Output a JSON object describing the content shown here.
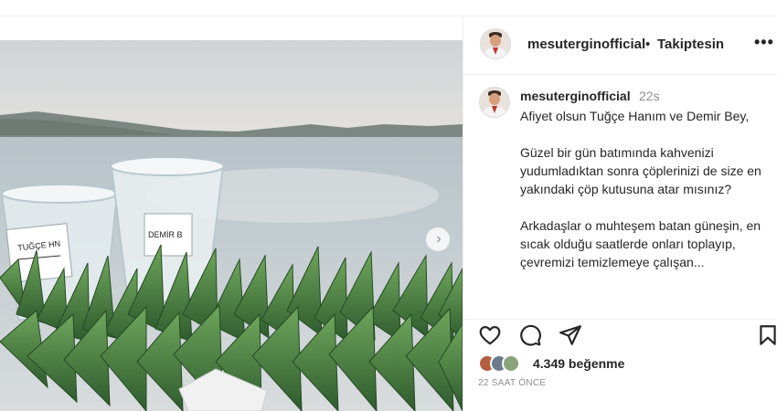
{
  "post": {
    "username": "mesuterginofficial",
    "separator": "•",
    "follow_status": "Takiptesin",
    "more_label": "•••",
    "next_label": "›",
    "cup_left_label": "TUĞÇE HN",
    "cup_right_label": "DEMİR B",
    "comment": {
      "username": "mesuterginofficial",
      "time": "22s",
      "lines": [
        "Afiyet olsun Tuğçe Hanım ve Demir Bey,",
        "Güzel bir gün batımında kahvenizi yudumladıktan sonra çöplerinizi de size en yakındaki çöp kutusuna atar mısınız?",
        "Arkadaşlar o muhteşem batan güneşin, en sıcak olduğu saatlerde onları toplayıp, çevremizi temizlemeye çalışan..."
      ]
    },
    "likes": "4.349 beğenme",
    "time_ago": "22 SAAT ÖNCE"
  },
  "colors": {
    "text": "#262626",
    "muted": "#8e8e8e",
    "border": "#efefef"
  }
}
